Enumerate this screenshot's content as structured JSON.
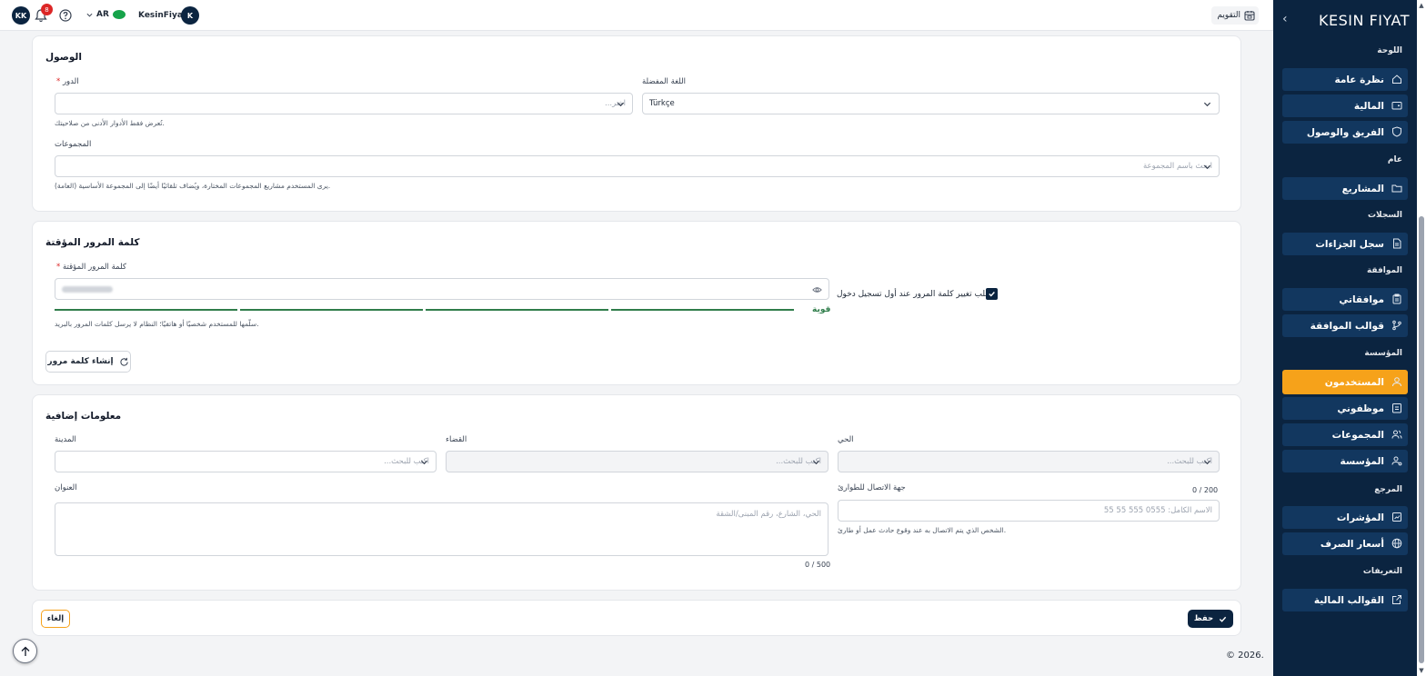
{
  "app": {
    "logo": "KESIN FIYAT"
  },
  "topbar": {
    "user_initials": "KK",
    "notification_count": "8",
    "language": "AR",
    "username": "KesinFiyat",
    "user_avatar": "K",
    "calendar_label": "التقويم"
  },
  "sidebar": {
    "sections": {
      "dashboard": "اللوحة",
      "general": "عام",
      "records": "السجلات",
      "approval": "الموافقة",
      "organization": "المؤسسة",
      "reference": "المرجع",
      "definitions": "التعريفات"
    },
    "items": {
      "overview": "نظرة عامة",
      "finance": "المالية",
      "team_access": "الفريق والوصول",
      "projects": "المشاريع",
      "penalties": "سجل الجزاءات",
      "my_approvals": "موافقاتي",
      "approval_templates": "قوالب الموافقة",
      "users": "المستخدمون",
      "employees": "موظفوني",
      "groups": "المجموعات",
      "organization": "المؤسسة",
      "indicators": "المؤشرات",
      "exchange_rates": "أسعار الصرف",
      "financial_templates": "القوالب المالية"
    },
    "active": "users"
  },
  "access": {
    "title": "الوصول",
    "role_label": "الدور",
    "role_placeholder": "اختر...",
    "role_hint": "تُعرض فقط الأدوار الأدنى من صلاحيتك.",
    "language_label": "اللغة المفضلة",
    "language_value": "Türkçe",
    "groups_label": "المجموعات",
    "groups_placeholder": "ابحث باسم المجموعة",
    "groups_hint": "يرى المستخدم مشاريع المجموعات المختارة، ويُضاف تلقائيًا أيضًا إلى المجموعة الأساسية (العامة)."
  },
  "password": {
    "title": "كلمة المرور المؤقتة",
    "label": "كلمة المرور المؤقتة",
    "strength": "قوية",
    "hint": "سلّمها للمستخدم شخصيًا أو هاتفيًا؛ النظام لا يرسل كلمات المرور بالبريد.",
    "require_change_label": "طلب تغيير كلمة المرور عند أول تسجيل دخول",
    "require_change_checked": true,
    "strength_segments": 4,
    "generate_button": "إنشاء كلمة مرور"
  },
  "extra": {
    "title": "معلومات إضافية",
    "city_label": "المدينة",
    "city_placeholder": "اكتب للبحث...",
    "district_label": "القضاء",
    "district_placeholder": "اكتب للبحث...",
    "neighborhood_label": "الحي",
    "neighborhood_placeholder": "اكتب للبحث...",
    "address_label": "العنوان",
    "address_placeholder": "الحي، الشارع، رقم المبنى/الشقة",
    "address_counter": "0 / 500",
    "emergency_label": "جهة الاتصال للطوارئ",
    "emergency_placeholder": "الاسم الكامل: 0555 555 55 55",
    "emergency_counter": "0 / 200",
    "emergency_hint": "الشخص الذي يتم الاتصال به عند وقوع حادث عمل أو طارئ."
  },
  "actions": {
    "cancel": "إلغاء",
    "save": "حفظ"
  },
  "footer": {
    "copyright": "© 2026."
  }
}
